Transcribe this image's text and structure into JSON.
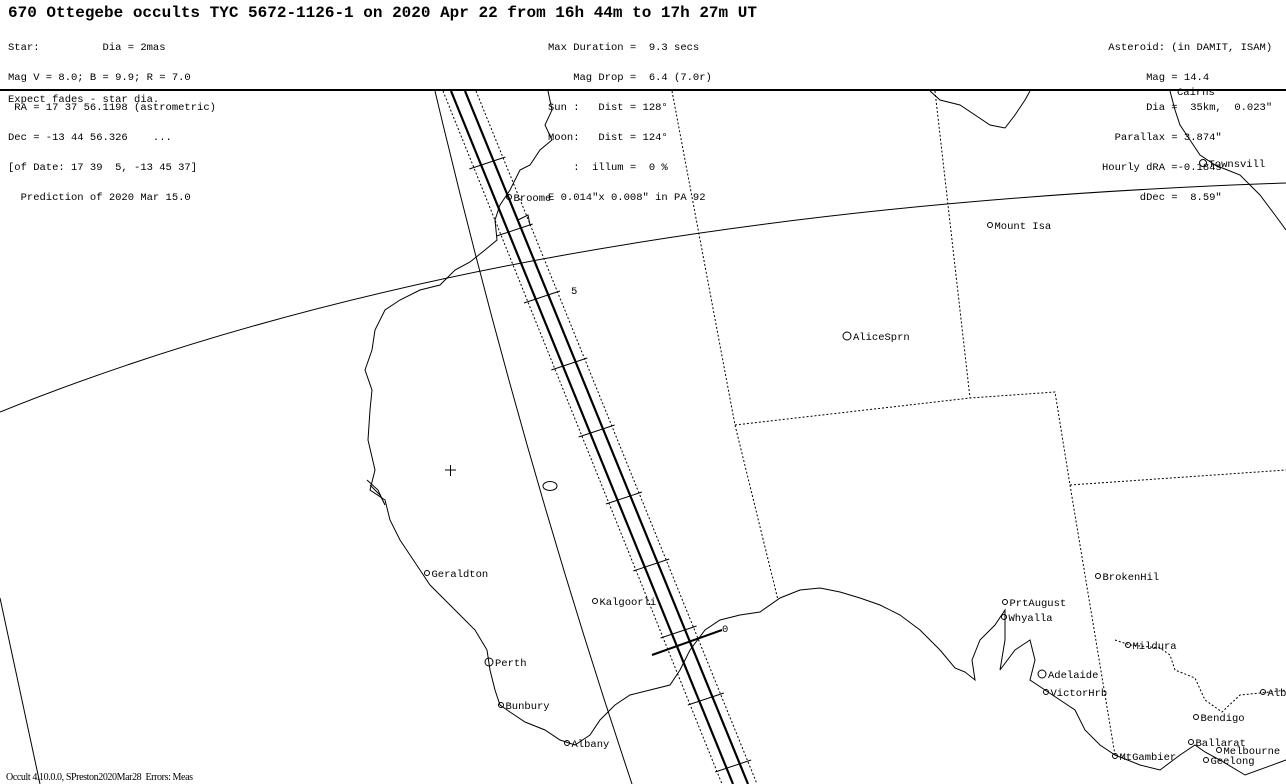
{
  "header": {
    "title": "670 Ottegebe occults TYC 5672-1126-1 on 2020 Apr 22 from 16h 44m to 17h 27m UT",
    "star": [
      "Star:          Dia = 2mas",
      "Mag V = 8.0; B = 9.9; R = 7.0",
      " RA = 17 37 56.1198 (astrometric)",
      "Dec = -13 44 56.326    ...",
      "[of Date: 17 39  5, -13 45 37]",
      "  Prediction of 2020 Mar 15.0"
    ],
    "event": [
      "Max Duration =  9.3 secs",
      "    Mag Drop =  6.4 (7.0r)",
      "Sun :   Dist = 128°",
      "Moon:   Dist = 124°",
      "    :  illum =  0 %",
      "E 0.014\"x 0.008\" in PA 92"
    ],
    "asteroid": [
      " Asteroid: (in DAMIT, ISAM)",
      "       Mag = 14.4",
      "       Dia =  35km,  0.023\"",
      "  Parallax = 3.874\"",
      "Hourly dRA =-0.184s",
      "      dDec =  8.59\""
    ]
  },
  "note": "Expect fades - star dia.",
  "footer": "Occult 4.10.0.0, SPreston2020Mar28  Errors: Meas",
  "map": {
    "path_tick_labels": [
      "5",
      "0"
    ],
    "cities": [
      "Cairns",
      "Townsvill",
      "Broome",
      "Mount Isa",
      "AliceSprn",
      "Geraldton",
      "Kalgoorli",
      "Perth",
      "Bunbury",
      "Albany",
      "PrtAugust",
      "Whyalla",
      "BrokenHil",
      "Mildura",
      "Adelaide",
      "VictorHrb",
      "Bendigo",
      "Ballarat",
      "Melbourne",
      "Geelong",
      "MtGambier",
      "Alb"
    ],
    "colors": {
      "city_label": "#000000",
      "lines": "#000000"
    }
  }
}
